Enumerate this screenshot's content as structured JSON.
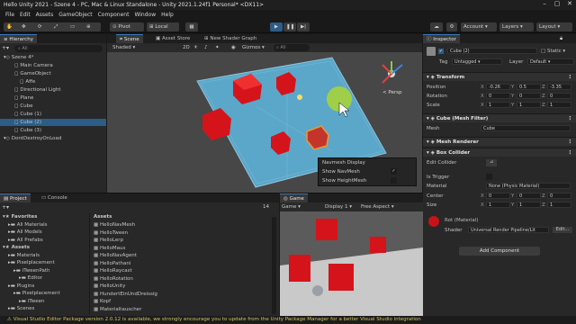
{
  "window": {
    "title": "Hello Unity 2021 - Szene 4 - PC, Mac & Linux Standalone - Unity 2021.1.24f1 Personal* <DX11>"
  },
  "menu": [
    "File",
    "Edit",
    "Assets",
    "GameObject",
    "Component",
    "Window",
    "Help"
  ],
  "toolbar": {
    "pivot": "Pivot",
    "local": "Local",
    "account": "Account",
    "layers": "Layers",
    "layout": "Layout"
  },
  "hierarchy": {
    "tab": "Hierarchy",
    "search_placeholder": "All",
    "items": [
      {
        "label": "Szene 4*",
        "indent": 0
      },
      {
        "label": "Main Camera",
        "indent": 2
      },
      {
        "label": "GameObject",
        "indent": 2
      },
      {
        "label": "Affe",
        "indent": 3
      },
      {
        "label": "Directional Light",
        "indent": 2
      },
      {
        "label": "Plane",
        "indent": 2
      },
      {
        "label": "Cube",
        "indent": 2
      },
      {
        "label": "Cube (1)",
        "indent": 2
      },
      {
        "label": "Cube (2)",
        "indent": 2
      },
      {
        "label": "Cube (3)",
        "indent": 2
      },
      {
        "label": "DontDestroyOnLoad",
        "indent": 0
      }
    ]
  },
  "scene": {
    "tabs": [
      "Scene",
      "Asset Store",
      "New Shader Graph"
    ],
    "shading": "Shaded",
    "mode": "2D",
    "gizmos": "Gizmos",
    "search": "All",
    "persp": "< Persp",
    "overlay": {
      "title": "Navmesh Display",
      "items": [
        "Show NavMesh",
        "Show HeightMesh"
      ]
    }
  },
  "project": {
    "tabs": [
      "Project",
      "Console"
    ],
    "count": "14",
    "tree": [
      {
        "label": "Favorites",
        "indent": 0,
        "bold": true
      },
      {
        "label": "All Materials",
        "indent": 1
      },
      {
        "label": "All Models",
        "indent": 1
      },
      {
        "label": "All Prefabs",
        "indent": 1
      },
      {
        "label": "Assets",
        "indent": 0,
        "bold": true
      },
      {
        "label": "Materials",
        "indent": 1
      },
      {
        "label": "Pixelplacement",
        "indent": 1
      },
      {
        "label": "iTweenPath",
        "indent": 2
      },
      {
        "label": "Editor",
        "indent": 3
      },
      {
        "label": "Plugins",
        "indent": 1
      },
      {
        "label": "Pixelplacement",
        "indent": 2
      },
      {
        "label": "iTween",
        "indent": 3
      },
      {
        "label": "Scenes",
        "indent": 1
      }
    ],
    "breadcrumb": "Assets",
    "files": [
      "HelloNavMesh",
      "HelloTween",
      "HelloLerp",
      "HelloMaus",
      "HelloNavAgent",
      "HelloPathani",
      "HelloRaycast",
      "HelloRotation",
      "HelloUnity",
      "HundertEinUndDreissig",
      "Kopf",
      "Materialtauscher"
    ]
  },
  "game": {
    "tab": "Game",
    "display": "Game",
    "display_num": "Display 1",
    "aspect": "Free Aspect"
  },
  "inspector": {
    "tab": "Inspector",
    "object_name": "Cube (2)",
    "static": "Static",
    "tag_label": "Tag",
    "tag": "Untagged",
    "layer_label": "Layer",
    "layer": "Default",
    "transform": {
      "title": "Transform",
      "rows": [
        {
          "label": "Position",
          "x": "-0.26",
          "y": "0.5",
          "z": "-3.35"
        },
        {
          "label": "Rotation",
          "x": "0",
          "y": "0",
          "z": "0"
        },
        {
          "label": "Scale",
          "x": "1",
          "y": "1",
          "z": "1"
        }
      ]
    },
    "mesh_filter": {
      "title": "Cube (Mesh Filter)",
      "mesh_label": "Mesh",
      "mesh": "Cube"
    },
    "mesh_renderer": {
      "title": "Mesh Renderer"
    },
    "box_collider": {
      "title": "Box Collider",
      "edit_label": "Edit Collider",
      "trigger_label": "Is Trigger",
      "material_label": "Material",
      "material": "None (Physic Material)",
      "center_label": "Center",
      "center": {
        "x": "0",
        "y": "0",
        "z": "0"
      },
      "size_label": "Size",
      "size": {
        "x": "1",
        "y": "1",
        "z": "1"
      }
    },
    "material": {
      "name": "Rot (Material)",
      "shader_label": "Shader",
      "shader": "Universal Render Pipeline/Lit",
      "edit": "Edit..."
    },
    "add_component": "Add Component"
  },
  "status": {
    "text": "Visual Studio Editor Package version 2.0.12 is available, we strongly encourage you to update from the Unity Package Manager for a better Visual Studio integration"
  },
  "colors": {
    "accent": "#2c5d87",
    "cube_red": "#d4141a",
    "plane": "#5ba7c9",
    "warning": "#d7c25f"
  }
}
